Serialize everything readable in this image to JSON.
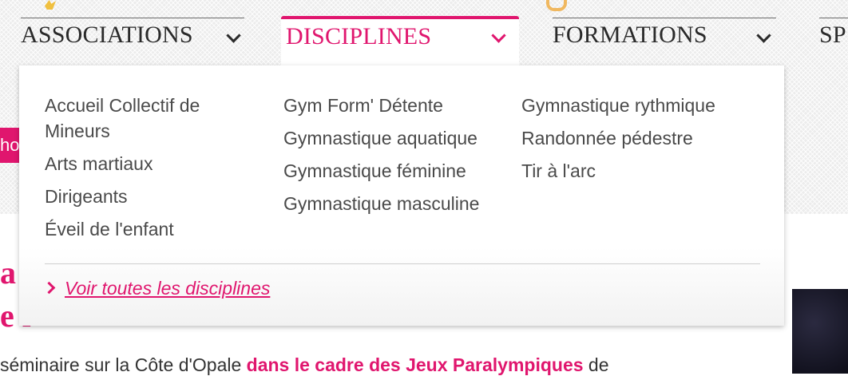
{
  "nav": {
    "tabs": [
      {
        "label": "ASSOCIATIONS"
      },
      {
        "label": "DISCIPLINES"
      },
      {
        "label": "FORMATIONS"
      },
      {
        "label": "SP"
      }
    ]
  },
  "side_tag": "ho",
  "dropdown": {
    "col1": [
      "Accueil Collectif de Mineurs",
      "Arts martiaux",
      "Dirigeants",
      "Éveil de l'enfant"
    ],
    "col2": [
      "Gym Form' Détente",
      "Gymnastique aquatique",
      "Gymnastique féminine",
      "Gymnastique masculine"
    ],
    "col3": [
      "Gymnastique rythmique",
      "Randonnée pédestre",
      "Tir à l'arc"
    ],
    "see_all": "Voir toutes les disciplines"
  },
  "background": {
    "heading_line1": "a",
    "heading_line2": "e l",
    "paragraph_start": "séminaire sur la Côte d'Opale ",
    "paragraph_bold": "dans le cadre des Jeux Paralympiques",
    "paragraph_end": " de"
  },
  "colors": {
    "accent": "#e0166e",
    "text": "#4a4a4a",
    "nav_text": "#2a2a2a"
  },
  "icons": [
    "chevron-down-icon",
    "chevron-right-icon"
  ]
}
